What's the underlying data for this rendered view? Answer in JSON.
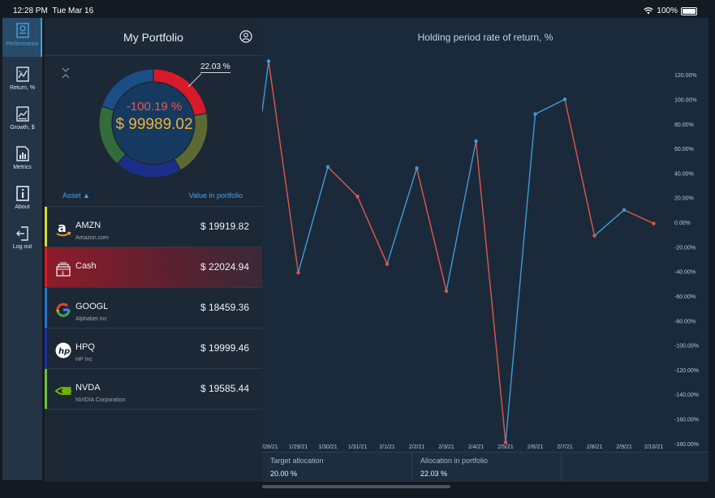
{
  "status": {
    "time": "12:28 PM",
    "date": "Tue Mar 16",
    "battery": "100%"
  },
  "nav": [
    {
      "label": "Performance",
      "icon": "performance-icon",
      "active": true
    },
    {
      "label": "Return, %",
      "icon": "return-icon"
    },
    {
      "label": "Growth, $",
      "icon": "growth-icon"
    },
    {
      "label": "Metrics",
      "icon": "metrics-icon"
    },
    {
      "label": "About",
      "icon": "info-icon"
    },
    {
      "label": "Log out",
      "icon": "logout-icon"
    }
  ],
  "portfolio": {
    "title": "My Portfolio",
    "slice_label": "22.03 %",
    "return_pct": "-100.19 %",
    "total_value": "$ 99989.02",
    "col_asset": "Asset ▲",
    "col_value": "Value in portfolio",
    "donut": [
      {
        "name": "Cash",
        "value": 22.03,
        "color": "#d7192a"
      },
      {
        "name": "NVDA",
        "value": 19.59,
        "color": "#5b6a33"
      },
      {
        "name": "HPQ",
        "value": 20.0,
        "color": "#1b2f8a"
      },
      {
        "name": "GOOGL",
        "value": 18.46,
        "color": "#346b3a"
      },
      {
        "name": "AMZN",
        "value": 19.92,
        "color": "#1b4e86"
      }
    ],
    "assets": [
      {
        "ticker": "AMZN",
        "name": "Amazon.com",
        "value": "$ 19919.82",
        "color": "#d8d73c",
        "icon": "amazon-icon"
      },
      {
        "ticker": "Cash",
        "name": "",
        "value": "$ 22024.94",
        "color": "#d7192a",
        "icon": "cash-icon",
        "selected": true
      },
      {
        "ticker": "GOOGL",
        "name": "Alphabet Inc",
        "value": "$ 18459.36",
        "color": "#1e78d0",
        "icon": "google-icon"
      },
      {
        "ticker": "HPQ",
        "name": "HP Inc",
        "value": "$ 19999.46",
        "color": "#1d2ea9",
        "icon": "hp-icon"
      },
      {
        "ticker": "NVDA",
        "name": "NVIDIA Corporation",
        "value": "$ 19585.44",
        "color": "#6fc23a",
        "icon": "nvidia-icon"
      }
    ]
  },
  "chart_title": "Holding period rate of return, %",
  "chart_data": {
    "type": "line",
    "title": "Holding period rate of return, %",
    "x": [
      "1/28/21",
      "1/29/21",
      "1/30/21",
      "1/31/21",
      "2/1/21",
      "2/2/21",
      "2/3/21",
      "2/4/21",
      "2/5/21",
      "2/6/21",
      "2/7/21",
      "2/8/21",
      "2/9/21",
      "2/10/21"
    ],
    "x_ticks": [
      "1/28/21",
      "1/29/21",
      "1/30/21",
      "1/31/21",
      "2/1/21",
      "2/2/21",
      "2/3/21",
      "2/4/21",
      "2/5/21",
      "2/6/21",
      "2/7/21",
      "2/8/21",
      "2/9/21",
      "2/10/21"
    ],
    "values": [
      131,
      -41,
      45,
      21,
      -34,
      44,
      -56,
      66,
      -179,
      88,
      100,
      -11,
      10,
      -1
    ],
    "up_color": "#3f9bd6",
    "down_color": "#e0574a",
    "ylim": [
      -190,
      130
    ],
    "y_ticks": [
      "120.00%",
      "100.00%",
      "80.00%",
      "60.00%",
      "40.00%",
      "20.00%",
      "0.00%",
      "-20.00%",
      "-40.00%",
      "-60.00%",
      "-80.00%",
      "-100.00%",
      "-120.00%",
      "-140.00%",
      "-160.00%",
      "-180.00%"
    ]
  },
  "allocation": {
    "target_label": "Target allocation",
    "target_value": "20.00 %",
    "actual_label": "Allocation in portfolio",
    "actual_value": "22.03 %"
  }
}
